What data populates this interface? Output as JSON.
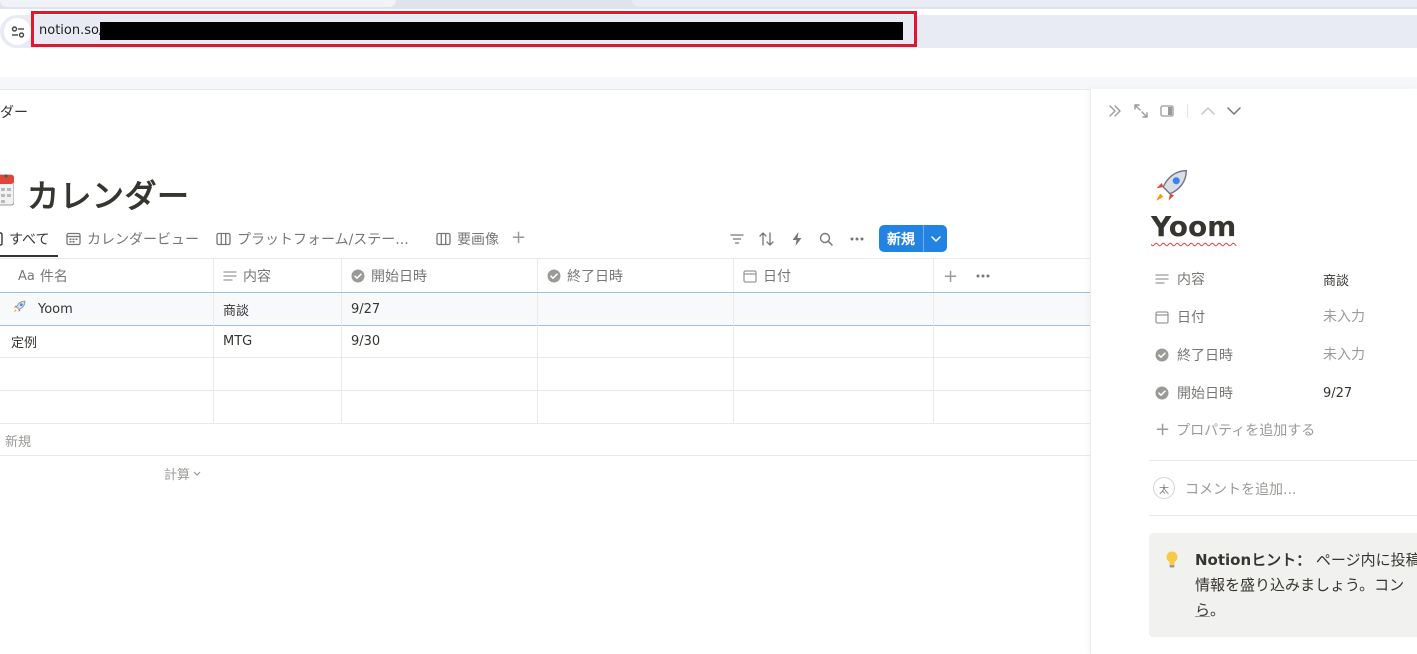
{
  "browser": {
    "url": "notion.so/",
    "icons": {
      "site_info": "tune-icon"
    }
  },
  "breadcrumb": "ダー",
  "page": {
    "title": "カレンダー",
    "icon": "calendar-icon"
  },
  "views": {
    "tabs": [
      {
        "label": "すべて",
        "icon": "table-icon",
        "active": true
      },
      {
        "label": "カレンダービュー",
        "icon": "calendar-icon",
        "active": false
      },
      {
        "label": "プラットフォーム/ステー...",
        "icon": "board-icon",
        "active": false
      },
      {
        "label": "要画像",
        "icon": "board-icon",
        "active": false
      }
    ],
    "add_view": "+"
  },
  "toolbar": {
    "new_button": "新規",
    "icons": [
      "filter-icon",
      "sort-icon",
      "automation-icon",
      "search-icon",
      "more-icon"
    ]
  },
  "table": {
    "headers": [
      {
        "label": "件名",
        "prefix": "Aa",
        "icon": "title-icon"
      },
      {
        "label": "内容",
        "icon": "text-icon"
      },
      {
        "label": "開始日時",
        "icon": "status-check-icon"
      },
      {
        "label": "終了日時",
        "icon": "status-check-icon"
      },
      {
        "label": "日付",
        "icon": "date-icon"
      }
    ],
    "rows": [
      {
        "title": "Yoom",
        "icon": "rocket-icon",
        "content": "商談",
        "start": "9/27",
        "end": "",
        "date": ""
      },
      {
        "title": "定例",
        "icon": "",
        "content": "MTG",
        "start": "9/30",
        "end": "",
        "date": ""
      },
      {
        "title": "",
        "icon": "",
        "content": "",
        "start": "",
        "end": "",
        "date": ""
      },
      {
        "title": "",
        "icon": "",
        "content": "",
        "start": "",
        "end": "",
        "date": ""
      }
    ],
    "add_row": "新規",
    "calculate": "計算"
  },
  "peek": {
    "title": "Yoom",
    "icon": "rocket-icon",
    "properties": [
      {
        "label": "内容",
        "icon": "text-icon",
        "value": "商談",
        "empty": false
      },
      {
        "label": "日付",
        "icon": "date-icon",
        "value": "未入力",
        "empty": true
      },
      {
        "label": "終了日時",
        "icon": "status-check-icon",
        "value": "未入力",
        "empty": true
      },
      {
        "label": "開始日時",
        "icon": "status-check-icon",
        "value": "9/27",
        "empty": false
      }
    ],
    "add_property": "プロパティを追加する",
    "comment_avatar": "太",
    "comment_placeholder": "コメントを追加...",
    "hint": {
      "bold": "Notionヒント：",
      "text": " ページ内に投稿",
      "line2": "情報を盛り込みましょう。コン",
      "link": "ら",
      "end": "。"
    }
  },
  "colors": {
    "accent": "#2383e2",
    "highlight_border": "#e0182f",
    "text": "#37352f",
    "muted": "#787774"
  }
}
